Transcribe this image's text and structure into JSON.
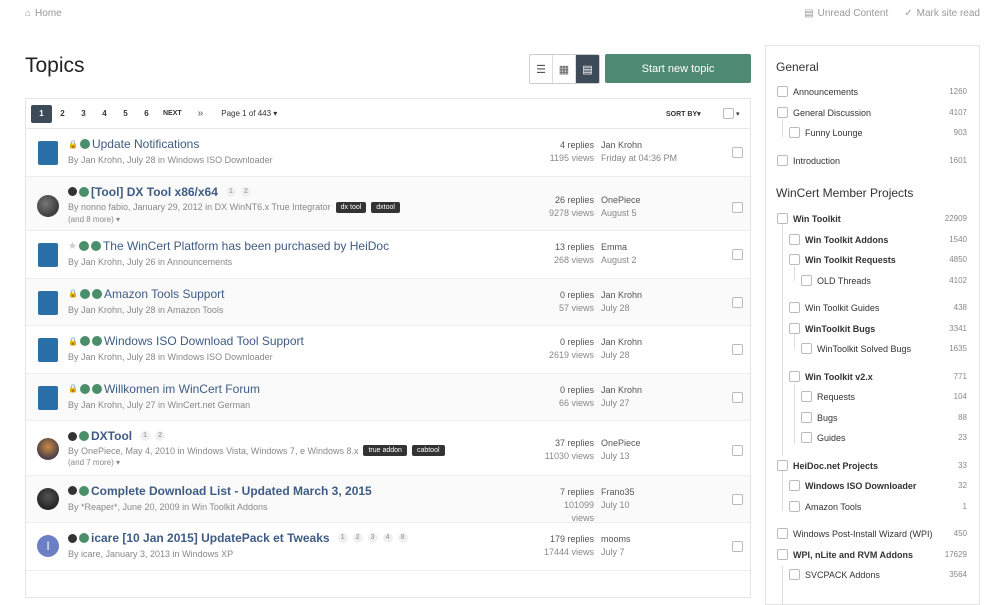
{
  "topbar": {
    "home": "Home",
    "unread": "Unread Content",
    "mark_read": "Mark site read"
  },
  "page_title": "Topics",
  "new_topic_label": "Start new topic",
  "pager": {
    "pages": [
      "1",
      "2",
      "3",
      "4",
      "5",
      "6"
    ],
    "next": "NEXT",
    "last": "»",
    "page_of": "Page 1 of 443",
    "sort_by": "SORT BY"
  },
  "topics": [
    {
      "title": "Update Notifications",
      "meta": "By Jan Krohn, July 28 in Windows ISO Downloader",
      "replies": "4 replies",
      "views": "1195 views",
      "last_user": "Jan Krohn",
      "last_date": "Friday at 04:36 PM"
    },
    {
      "title": "[Tool] DX Tool x86/x64",
      "meta": "By nonno fabio, January 29, 2012 in DX WinNT6.x True Integrator",
      "tags": [
        "dx tool",
        "dxtool"
      ],
      "more": "(and 8 more)",
      "pages": [
        "1",
        "2"
      ],
      "replies": "26 replies",
      "views": "9278 views",
      "last_user": "OnePiece",
      "last_date": "August 5"
    },
    {
      "title": "The WinCert Platform has been purchased by HeiDoc",
      "meta": "By Jan Krohn, July 26 in Announcements",
      "replies": "13 replies",
      "views": "268 views",
      "last_user": "Emma",
      "last_date": "August 2"
    },
    {
      "title": "Amazon Tools Support",
      "meta": "By Jan Krohn, July 28 in Amazon Tools",
      "replies": "0 replies",
      "views": "57 views",
      "last_user": "Jan Krohn",
      "last_date": "July 28"
    },
    {
      "title": "Windows ISO Download Tool Support",
      "meta": "By Jan Krohn, July 28 in Windows ISO Downloader",
      "replies": "0 replies",
      "views": "2619 views",
      "last_user": "Jan Krohn",
      "last_date": "July 28"
    },
    {
      "title": "Willkomen im WinCert Forum",
      "meta": "By Jan Krohn, July 27 in WinCert.net German",
      "replies": "0 replies",
      "views": "66 views",
      "last_user": "Jan Krohn",
      "last_date": "July 27"
    },
    {
      "title": "DXTool",
      "meta": "By OnePiece, May 4, 2010 in Windows Vista, Windows 7, e Windows 8.x",
      "tags": [
        "true addon",
        "cabtool"
      ],
      "more": "(and 7 more)",
      "pages": [
        "1",
        "2"
      ],
      "replies": "37 replies",
      "views": "11030 views",
      "last_user": "OnePiece",
      "last_date": "July 13"
    },
    {
      "title": "Complete Download List - Updated March 3, 2015",
      "meta": "By *Reaper*, June 20, 2009 in Win Toolkit Addons",
      "replies": "7 replies",
      "views": "101099 views",
      "last_user": "Frano35",
      "last_date": "July 10"
    },
    {
      "title": "icare [10 Jan 2015] UpdatePack et Tweaks",
      "meta": "By icare, January 3, 2013 in Windows XP",
      "pages": [
        "1",
        "2",
        "3",
        "4",
        "8"
      ],
      "replies": "179 replies",
      "views": "17444 views",
      "last_user": "mooms",
      "last_date": "July 7",
      "avatar_letter": "I"
    }
  ],
  "sidebar": {
    "general_title": "General",
    "general": [
      {
        "label": "Announcements",
        "count": "1260"
      },
      {
        "label": "General Discussion",
        "count": "4107"
      },
      {
        "label": "Funny Lounge",
        "count": "903"
      },
      {
        "label": "Introduction",
        "count": "1601"
      }
    ],
    "projects_title": "WinCert Member Projects",
    "projects": [
      {
        "label": "Win Toolkit",
        "count": "22909"
      },
      {
        "label": "Win Toolkit Addons",
        "count": "1540"
      },
      {
        "label": "Win Toolkit Requests",
        "count": "4850"
      },
      {
        "label": "OLD Threads",
        "count": "4102"
      },
      {
        "label": "Win Toolkit Guides",
        "count": "438"
      },
      {
        "label": "WinToolkit Bugs",
        "count": "3341"
      },
      {
        "label": "WinToolkit Solved Bugs",
        "count": "1635"
      },
      {
        "label": "Win Toolkit v2.x",
        "count": "771"
      },
      {
        "label": "Requests",
        "count": "104"
      },
      {
        "label": "Bugs",
        "count": "88"
      },
      {
        "label": "Guides",
        "count": "23"
      },
      {
        "label": "HeiDoc.net Projects",
        "count": "33"
      },
      {
        "label": "Windows ISO Downloader",
        "count": "32"
      },
      {
        "label": "Amazon Tools",
        "count": "1"
      },
      {
        "label": "Windows Post-Install Wizard (WPI)",
        "count": "450"
      },
      {
        "label": "WPI, nLite and RVM Addons",
        "count": "17629"
      },
      {
        "label": "SVCPACK Addons",
        "count": "3564"
      }
    ]
  }
}
